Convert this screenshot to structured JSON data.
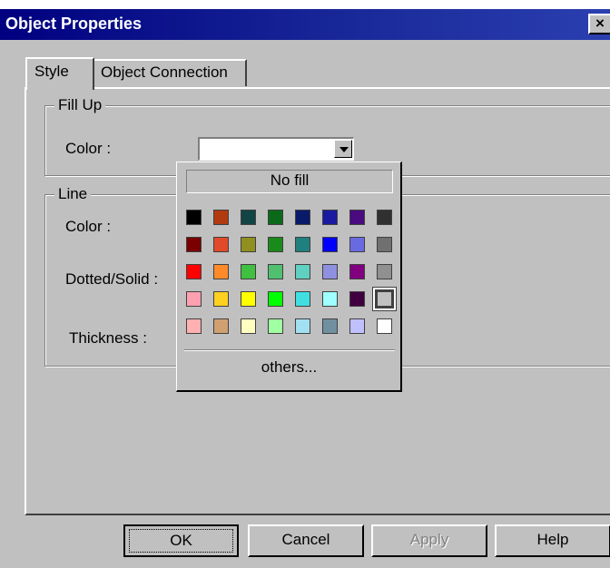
{
  "window": {
    "title": "Object Properties",
    "close_glyph": "×"
  },
  "tabs": [
    {
      "label": "Style",
      "active": true
    },
    {
      "label": "Object Connection",
      "active": false
    }
  ],
  "fill_up": {
    "legend": "Fill Up",
    "color_label": "Color :"
  },
  "line": {
    "legend": "Line",
    "color_label": "Color :",
    "dotted_label": "Dotted/Solid :",
    "thickness_label": "Thickness :"
  },
  "color_popup": {
    "no_fill_label": "No fill",
    "others_label": "others...",
    "selected_index": 31,
    "swatches": [
      "#000000",
      "#b23a10",
      "#114444",
      "#0a6a1a",
      "#0a1a6a",
      "#1a1aa0",
      "#4a0a80",
      "#303030",
      "#7a0000",
      "#e04a2a",
      "#909020",
      "#1a8a1a",
      "#208080",
      "#0000ff",
      "#6a6ae0",
      "#707070",
      "#ff0000",
      "#ff8a2a",
      "#40c040",
      "#50c070",
      "#60d0c0",
      "#9090e0",
      "#800080",
      "#909090",
      "#ffa0b0",
      "#ffd020",
      "#ffff00",
      "#00ff00",
      "#40e0e0",
      "#a0ffff",
      "#400040",
      "#c0c0c0",
      "#ffb0b0",
      "#d0a070",
      "#ffffc0",
      "#a0ffa0",
      "#a0e0f0",
      "#7090a0",
      "#c0c0ff",
      "#ffffff"
    ]
  },
  "buttons": {
    "ok": "OK",
    "cancel": "Cancel",
    "apply": "Apply",
    "help": "Help"
  }
}
